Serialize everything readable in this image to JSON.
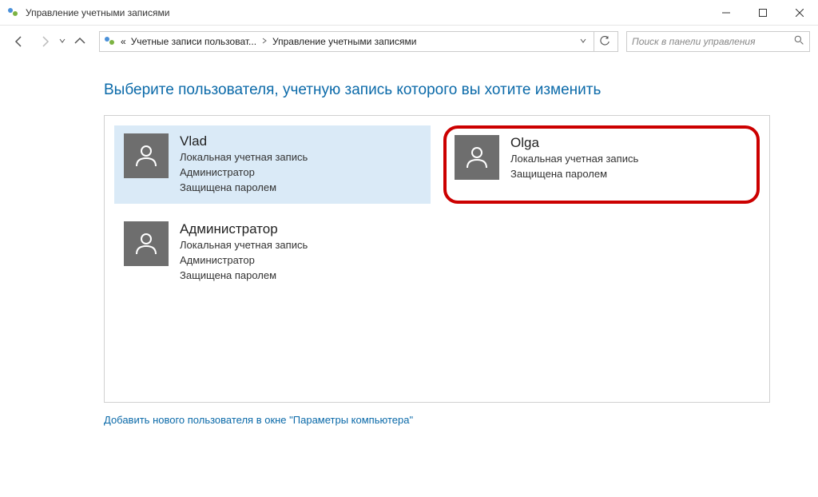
{
  "window": {
    "title": "Управление учетными записями"
  },
  "breadcrumb": {
    "prefix": "«",
    "item1": "Учетные записи пользоват...",
    "item2": "Управление учетными записями"
  },
  "search": {
    "placeholder": "Поиск в панели управления"
  },
  "main": {
    "heading": "Выберите пользователя, учетную запись которого вы хотите изменить",
    "add_link": "Добавить нового пользователя в окне \"Параметры компьютера\""
  },
  "accounts": [
    {
      "name": "Vlad",
      "type": "Локальная учетная запись",
      "role": "Администратор",
      "protected": "Защищена паролем",
      "selected": true,
      "highlighted": false
    },
    {
      "name": "Olga",
      "type": "Локальная учетная запись",
      "role": "",
      "protected": "Защищена паролем",
      "selected": false,
      "highlighted": true
    },
    {
      "name": "Администратор",
      "type": "Локальная учетная запись",
      "role": "Администратор",
      "protected": "Защищена паролем",
      "selected": false,
      "highlighted": false
    }
  ]
}
